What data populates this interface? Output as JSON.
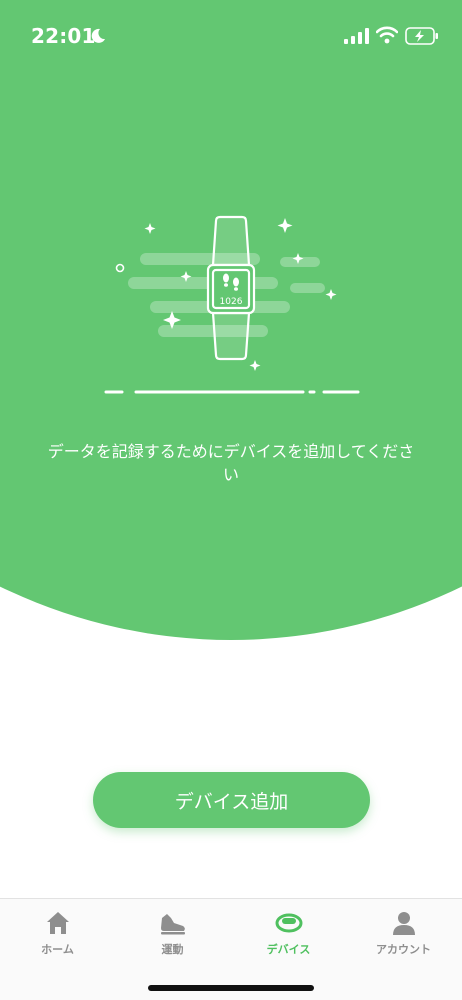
{
  "status_bar": {
    "time": "22:01",
    "moon_icon": "moon-icon",
    "signal_icon": "cellular-signal-icon",
    "wifi_icon": "wifi-icon",
    "battery_icon": "battery-charging-icon"
  },
  "hero": {
    "background_color": "#63c772",
    "device_step_count": "1026",
    "message": "データを記録するためにデバイスを追加してください"
  },
  "main": {
    "add_device_label": "デバイス追加",
    "button_color": "#63c772"
  },
  "tab_bar": {
    "active_color": "#4fc05f",
    "inactive_color": "#8e8e8e",
    "tabs": [
      {
        "label": "ホーム",
        "icon": "home-icon"
      },
      {
        "label": "運動",
        "icon": "sneaker-icon"
      },
      {
        "label": "デバイス",
        "icon": "band-device-icon"
      },
      {
        "label": "アカウント",
        "icon": "person-icon"
      }
    ]
  }
}
